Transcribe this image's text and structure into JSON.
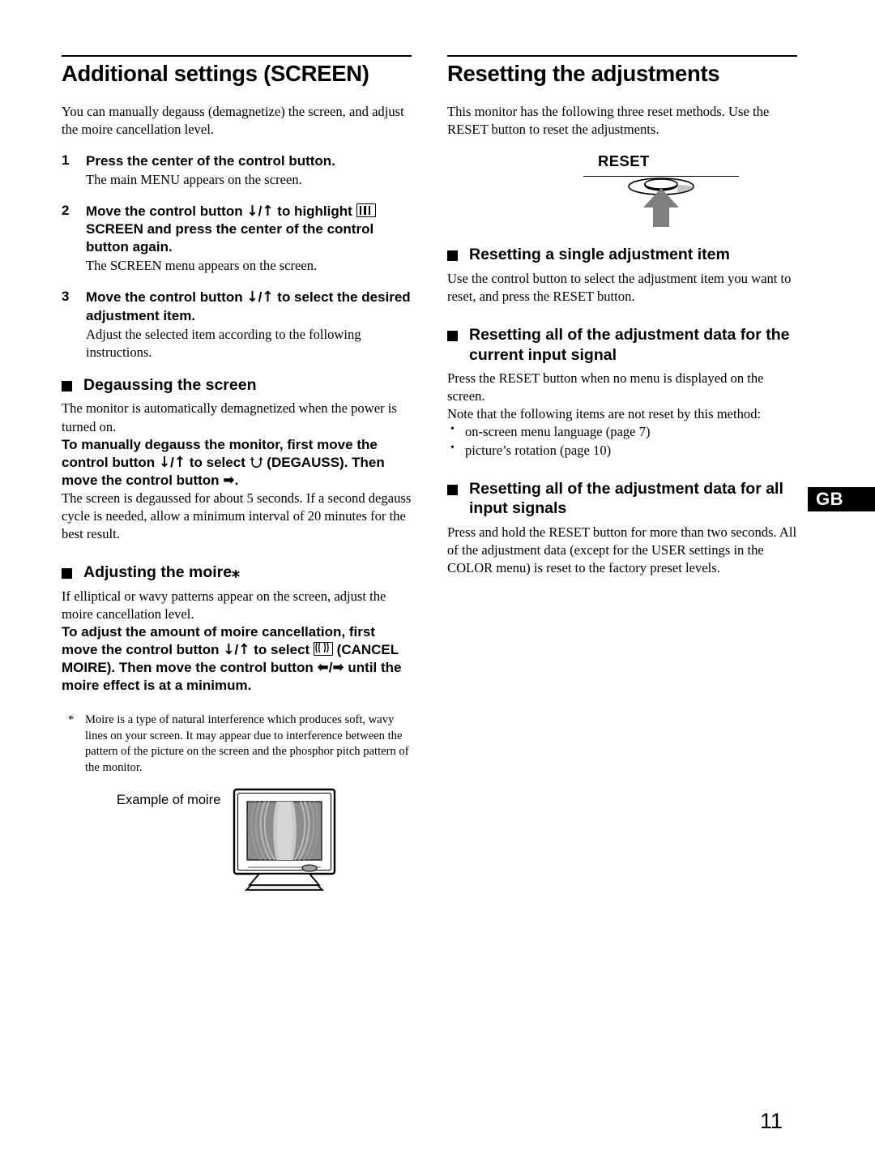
{
  "document": {
    "page_number": "11",
    "language_tab": "GB"
  },
  "left_column": {
    "title": "Additional settings (SCREEN)",
    "intro": "You can manually degauss (demagnetize) the screen, and adjust the moire cancellation level.",
    "steps": [
      {
        "number": "1",
        "heading": "Press the center of the control button.",
        "body": "The main MENU appears on the screen."
      },
      {
        "number": "2",
        "heading_part1": "Move the control button ",
        "heading_down": "↓",
        "heading_slash": "/",
        "heading_up": "↑",
        "heading_part2": " to highlight ",
        "heading_part3": "SCREEN and press the center of the control button again.",
        "body": "The SCREEN menu appears on the screen."
      },
      {
        "number": "3",
        "heading_part1": "Move the control button ",
        "heading_down": "↓",
        "heading_slash": "/",
        "heading_up": "↑",
        "heading_part2": " to select the desired adjustment item.",
        "body": "Adjust the selected item according to the following instructions."
      }
    ],
    "degauss": {
      "heading": "Degaussing the screen",
      "para1": "The monitor is automatically demagnetized when the power is turned on.",
      "instr_a": "To manually degauss the monitor, first move the control button ",
      "instr_down": "↓",
      "instr_slash": "/",
      "instr_up": "↑",
      "instr_b": " to select ",
      "instr_c": " (DEGAUSS). Then move the control button ",
      "instr_right": "➡",
      "instr_d": ".",
      "para2": "The screen is degaussed for about 5 seconds. If a second degauss cycle is needed, allow a minimum interval of 20 minutes for the best result."
    },
    "moire": {
      "heading": "Adjusting the moire",
      "heading_mark": "⁎",
      "para1": "If elliptical or wavy patterns appear on the screen, adjust the moire cancellation level.",
      "instr_a": "To adjust the amount of moire cancellation, first move the control button ",
      "instr_down": "↓",
      "instr_slash": "/",
      "instr_up": "↑",
      "instr_b": " to select ",
      "instr_c": " (CANCEL MOIRE). Then move the control button ",
      "instr_left": "⬅",
      "instr_slash2": "/",
      "instr_right": "➡",
      "instr_d": " until the moire effect is at a minimum.",
      "footnote_mark": "*",
      "footnote": "Moire is a type of natural interference which produces soft, wavy lines on your screen. It may appear due to interference between the pattern of the picture on the screen and the phosphor pitch pattern of the monitor.",
      "figure_caption": "Example of moire"
    }
  },
  "right_column": {
    "title": "Resetting the adjustments",
    "intro": "This monitor has the following three reset methods. Use the RESET button to reset the adjustments.",
    "reset_figure_label": "RESET",
    "sections": [
      {
        "heading": "Resetting a single adjustment item",
        "body": "Use the control button to select the adjustment item you want to reset, and press the RESET button."
      },
      {
        "heading": "Resetting all of the adjustment data for the current input signal",
        "body_line1": "Press the RESET button when no menu is displayed on the screen.",
        "body_line2": "Note that the following items are not reset by this method:",
        "bullets": [
          "on-screen menu language (page 7)",
          "picture’s rotation (page 10)"
        ]
      },
      {
        "heading": "Resetting all of the adjustment data for all input signals",
        "body": "Press and hold the RESET button for more than two seconds. All of the adjustment data (except for the USER settings in the COLOR menu) is reset to the factory preset levels."
      }
    ]
  },
  "icons": {
    "screen_icon": "screen-menu-icon",
    "degauss_icon": "degauss-magnet-icon",
    "moire_icon": "cancel-moire-icon",
    "arrow_down": "arrow-down-icon",
    "arrow_up": "arrow-up-icon",
    "arrow_left": "arrow-left-icon",
    "arrow_right": "arrow-right-icon"
  },
  "colors": {
    "text": "#000000",
    "background": "#ffffff",
    "tab_background": "#000000",
    "tab_text": "#ffffff",
    "illustration_gray": "#808080",
    "illustration_light_gray": "#c8c8c8"
  }
}
